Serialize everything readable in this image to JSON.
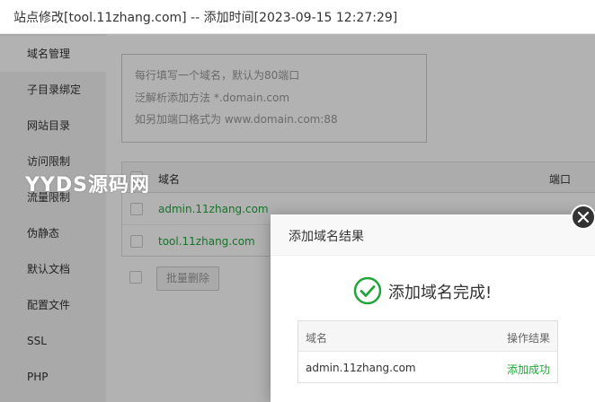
{
  "window": {
    "title": "站点修改[tool.11zhang.com] -- 添加时间[2023-09-15 12:27:29]"
  },
  "sidebar": {
    "items": [
      {
        "label": "域名管理",
        "active": true
      },
      {
        "label": "子目录绑定"
      },
      {
        "label": "网站目录"
      },
      {
        "label": "访问限制"
      },
      {
        "label": "流量限制"
      },
      {
        "label": "伪静态"
      },
      {
        "label": "默认文档"
      },
      {
        "label": "配置文件"
      },
      {
        "label": "SSL"
      },
      {
        "label": "PHP"
      }
    ]
  },
  "domain_input": {
    "placeholder_lines": [
      "每行填写一个域名，默认为80端口",
      "泛解析添加方法 *.domain.com",
      "如另加端口格式为 www.domain.com:88"
    ]
  },
  "domain_table": {
    "columns": [
      "域名",
      "端口"
    ],
    "rows": [
      {
        "domain": "admin.11zhang.com"
      },
      {
        "domain": "tool.11zhang.com"
      }
    ]
  },
  "batch_delete_label": "批量删除",
  "watermark_text": "YYDS源码网",
  "modal": {
    "title": "添加域名结果",
    "success_message": "添加域名完成!",
    "table": {
      "columns": [
        "域名",
        "操作结果"
      ],
      "rows": [
        {
          "domain": "admin.11zhang.com",
          "result": "添加成功"
        }
      ]
    }
  },
  "colors": {
    "accent_green": "#20a53a",
    "sidebar_bg": "#f2f2f2"
  },
  "icons": {
    "close": "close-icon",
    "success": "check-circle-icon"
  }
}
